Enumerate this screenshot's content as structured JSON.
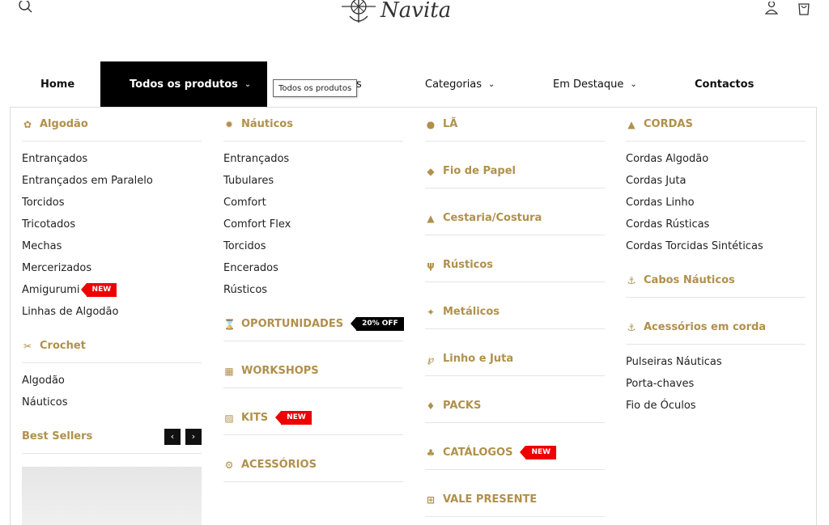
{
  "header": {
    "logo_text": "Navita"
  },
  "nav": {
    "home": "Home",
    "all_products": "Todos os produtos",
    "partial_hidden": "s",
    "categories": "Categorias",
    "featured": "Em Destaque",
    "contacts": "Contactos",
    "tooltip": "Todos os produtos"
  },
  "menu": {
    "algodao": {
      "title": "Algodão",
      "items": [
        "Entrançados",
        "Entrançados em Paralelo",
        "Torcidos",
        "Tricotados",
        "Mechas",
        "Mercerizados",
        "Amigurumi",
        "Linhas de Algodão"
      ],
      "amigurumi_badge": "NEW"
    },
    "crochet": {
      "title": "Crochet",
      "items": [
        "Algodão",
        "Náuticos"
      ]
    },
    "best_sellers": "Best Sellers",
    "nauticos": {
      "title": "Náuticos",
      "items": [
        "Entrançados",
        "Tubulares",
        "Comfort",
        "Comfort Flex",
        "Torcidos",
        "Encerados",
        "Rústicos"
      ]
    },
    "oportunidades": {
      "title": "OPORTUNIDADES",
      "badge": "20% OFF"
    },
    "workshops": {
      "title": "WORKSHOPS"
    },
    "kits": {
      "title": "KITS",
      "badge": "NEW"
    },
    "acessorios": {
      "title": "ACESSÓRIOS"
    },
    "la": "LÃ",
    "fio_papel": "Fio de Papel",
    "cestaria": "Cestaria/Costura",
    "rusticos": "Rústicos",
    "metalicos": "Metálicos",
    "linho_juta": "Linho e Juta",
    "packs": "PACKS",
    "catalogos": {
      "title": "CATÁLOGOS",
      "badge": "NEW"
    },
    "vale_presente": "VALE PRESENTE",
    "cordas": {
      "title": "CORDAS",
      "items": [
        "Cordas Algodão",
        "Cordas Juta",
        "Cordas Linho",
        "Cordas Rústicas",
        "Cordas Torcidas Sintéticas"
      ]
    },
    "cabos_nauticos": "Cabos Náuticos",
    "acessorios_corda": {
      "title": "Acessórios em corda",
      "items": [
        "Pulseiras Náuticas",
        "Porta-chaves",
        "Fio de Óculos"
      ]
    }
  },
  "colors": {
    "accent": "#b0904b",
    "badge_red": "#e00000",
    "badge_dark": "#000000"
  }
}
